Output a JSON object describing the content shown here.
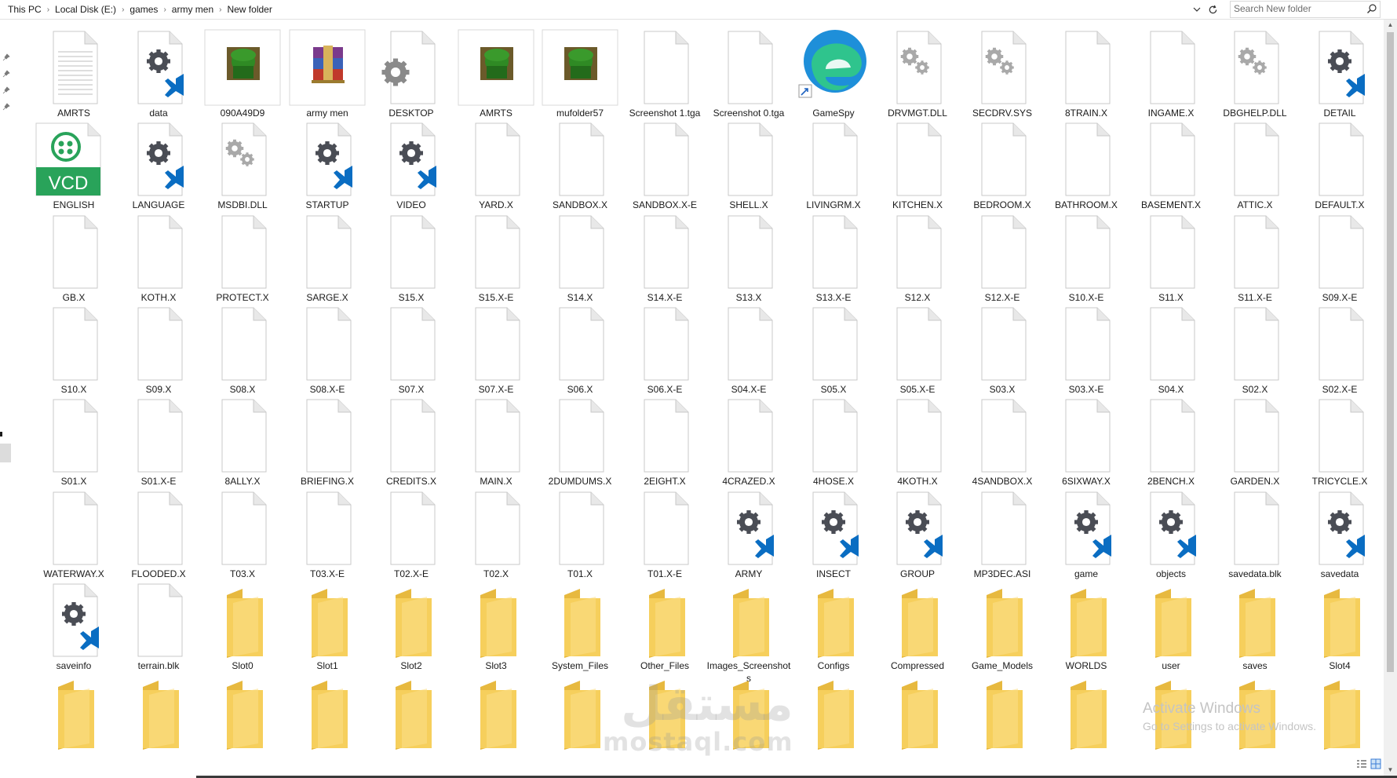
{
  "window": {
    "breadcrumb": [
      "This PC",
      "Local Disk (E:)",
      "games",
      "army men",
      "New folder"
    ],
    "search_placeholder": "Search New folder"
  },
  "colors": {
    "folder": "#f6cf5c",
    "folder_dark": "#e7b93f",
    "gear": "#4a4d55",
    "vscode_blue": "#0a6dc2",
    "soldier_green": "#2f8a24",
    "vcd_green": "#29a35a"
  },
  "items": [
    {
      "label": "AMRTS",
      "icon": "text-doc-icon"
    },
    {
      "label": "data",
      "icon": "vscode-gear-icon"
    },
    {
      "label": "090A49D9",
      "icon": "soldier-image-icon"
    },
    {
      "label": "army men",
      "icon": "winrar-icon"
    },
    {
      "label": "DESKTOP",
      "icon": "gear-file-icon"
    },
    {
      "label": "AMRTS",
      "icon": "soldier-image-icon"
    },
    {
      "label": "mufolder57",
      "icon": "soldier-image-icon"
    },
    {
      "label": "Screenshot 1.tga",
      "icon": "blank-file-icon"
    },
    {
      "label": "Screenshot 0.tga",
      "icon": "blank-file-icon"
    },
    {
      "label": "GameSpy",
      "icon": "edge-shortcut-icon"
    },
    {
      "label": "DRVMGT.DLL",
      "icon": "dll-gear-icon"
    },
    {
      "label": "SECDRV.SYS",
      "icon": "dll-gear-icon"
    },
    {
      "label": "8TRAIN.X",
      "icon": "blank-file-icon"
    },
    {
      "label": "INGAME.X",
      "icon": "blank-file-icon"
    },
    {
      "label": "DBGHELP.DLL",
      "icon": "dll-gear-icon"
    },
    {
      "label": "DETAIL",
      "icon": "vscode-gear-icon"
    },
    {
      "label": "ENGLISH",
      "icon": "vcd-file-icon"
    },
    {
      "label": "LANGUAGE",
      "icon": "vscode-gear-icon"
    },
    {
      "label": "MSDBI.DLL",
      "icon": "dll-gear-icon"
    },
    {
      "label": "STARTUP",
      "icon": "vscode-gear-icon"
    },
    {
      "label": "VIDEO",
      "icon": "vscode-gear-icon"
    },
    {
      "label": "YARD.X",
      "icon": "blank-file-icon"
    },
    {
      "label": "SANDBOX.X",
      "icon": "blank-file-icon"
    },
    {
      "label": "SANDBOX.X-E",
      "icon": "blank-file-icon"
    },
    {
      "label": "SHELL.X",
      "icon": "blank-file-icon"
    },
    {
      "label": "LIVINGRM.X",
      "icon": "blank-file-icon"
    },
    {
      "label": "KITCHEN.X",
      "icon": "blank-file-icon"
    },
    {
      "label": "BEDROOM.X",
      "icon": "blank-file-icon"
    },
    {
      "label": "BATHROOM.X",
      "icon": "blank-file-icon"
    },
    {
      "label": "BASEMENT.X",
      "icon": "blank-file-icon"
    },
    {
      "label": "ATTIC.X",
      "icon": "blank-file-icon"
    },
    {
      "label": "DEFAULT.X",
      "icon": "blank-file-icon"
    },
    {
      "label": "GB.X",
      "icon": "blank-file-icon"
    },
    {
      "label": "KOTH.X",
      "icon": "blank-file-icon"
    },
    {
      "label": "PROTECT.X",
      "icon": "blank-file-icon"
    },
    {
      "label": "SARGE.X",
      "icon": "blank-file-icon"
    },
    {
      "label": "S15.X",
      "icon": "blank-file-icon"
    },
    {
      "label": "S15.X-E",
      "icon": "blank-file-icon"
    },
    {
      "label": "S14.X",
      "icon": "blank-file-icon"
    },
    {
      "label": "S14.X-E",
      "icon": "blank-file-icon"
    },
    {
      "label": "S13.X",
      "icon": "blank-file-icon"
    },
    {
      "label": "S13.X-E",
      "icon": "blank-file-icon"
    },
    {
      "label": "S12.X",
      "icon": "blank-file-icon"
    },
    {
      "label": "S12.X-E",
      "icon": "blank-file-icon"
    },
    {
      "label": "S10.X-E",
      "icon": "blank-file-icon"
    },
    {
      "label": "S11.X",
      "icon": "blank-file-icon"
    },
    {
      "label": "S11.X-E",
      "icon": "blank-file-icon"
    },
    {
      "label": "S09.X-E",
      "icon": "blank-file-icon"
    },
    {
      "label": "S10.X",
      "icon": "blank-file-icon"
    },
    {
      "label": "S09.X",
      "icon": "blank-file-icon"
    },
    {
      "label": "S08.X",
      "icon": "blank-file-icon"
    },
    {
      "label": "S08.X-E",
      "icon": "blank-file-icon"
    },
    {
      "label": "S07.X",
      "icon": "blank-file-icon"
    },
    {
      "label": "S07.X-E",
      "icon": "blank-file-icon"
    },
    {
      "label": "S06.X",
      "icon": "blank-file-icon"
    },
    {
      "label": "S06.X-E",
      "icon": "blank-file-icon"
    },
    {
      "label": "S04.X-E",
      "icon": "blank-file-icon"
    },
    {
      "label": "S05.X",
      "icon": "blank-file-icon"
    },
    {
      "label": "S05.X-E",
      "icon": "blank-file-icon"
    },
    {
      "label": "S03.X",
      "icon": "blank-file-icon"
    },
    {
      "label": "S03.X-E",
      "icon": "blank-file-icon"
    },
    {
      "label": "S04.X",
      "icon": "blank-file-icon"
    },
    {
      "label": "S02.X",
      "icon": "blank-file-icon"
    },
    {
      "label": "S02.X-E",
      "icon": "blank-file-icon"
    },
    {
      "label": "S01.X",
      "icon": "blank-file-icon"
    },
    {
      "label": "S01.X-E",
      "icon": "blank-file-icon"
    },
    {
      "label": "8ALLY.X",
      "icon": "blank-file-icon"
    },
    {
      "label": "BRIEFING.X",
      "icon": "blank-file-icon"
    },
    {
      "label": "CREDITS.X",
      "icon": "blank-file-icon"
    },
    {
      "label": "MAIN.X",
      "icon": "blank-file-icon"
    },
    {
      "label": "2DUMDUMS.X",
      "icon": "blank-file-icon"
    },
    {
      "label": "2EIGHT.X",
      "icon": "blank-file-icon"
    },
    {
      "label": "4CRAZED.X",
      "icon": "blank-file-icon"
    },
    {
      "label": "4HOSE.X",
      "icon": "blank-file-icon"
    },
    {
      "label": "4KOTH.X",
      "icon": "blank-file-icon"
    },
    {
      "label": "4SANDBOX.X",
      "icon": "blank-file-icon"
    },
    {
      "label": "6SIXWAY.X",
      "icon": "blank-file-icon"
    },
    {
      "label": "2BENCH.X",
      "icon": "blank-file-icon"
    },
    {
      "label": "GARDEN.X",
      "icon": "blank-file-icon"
    },
    {
      "label": "TRICYCLE.X",
      "icon": "blank-file-icon"
    },
    {
      "label": "WATERWAY.X",
      "icon": "blank-file-icon"
    },
    {
      "label": "FLOODED.X",
      "icon": "blank-file-icon"
    },
    {
      "label": "T03.X",
      "icon": "blank-file-icon"
    },
    {
      "label": "T03.X-E",
      "icon": "blank-file-icon"
    },
    {
      "label": "T02.X-E",
      "icon": "blank-file-icon"
    },
    {
      "label": "T02.X",
      "icon": "blank-file-icon"
    },
    {
      "label": "T01.X",
      "icon": "blank-file-icon"
    },
    {
      "label": "T01.X-E",
      "icon": "blank-file-icon"
    },
    {
      "label": "ARMY",
      "icon": "vscode-gear-icon"
    },
    {
      "label": "INSECT",
      "icon": "vscode-gear-icon"
    },
    {
      "label": "GROUP",
      "icon": "vscode-gear-icon"
    },
    {
      "label": "MP3DEC.ASI",
      "icon": "blank-file-icon"
    },
    {
      "label": "game",
      "icon": "vscode-gear-icon"
    },
    {
      "label": "objects",
      "icon": "vscode-gear-icon"
    },
    {
      "label": "savedata.blk",
      "icon": "blank-file-icon"
    },
    {
      "label": "savedata",
      "icon": "vscode-gear-icon"
    },
    {
      "label": "saveinfo",
      "icon": "vscode-gear-icon"
    },
    {
      "label": "terrain.blk",
      "icon": "blank-file-icon"
    },
    {
      "label": "Slot0",
      "icon": "folder-icon"
    },
    {
      "label": "Slot1",
      "icon": "folder-icon"
    },
    {
      "label": "Slot2",
      "icon": "folder-icon"
    },
    {
      "label": "Slot3",
      "icon": "folder-icon"
    },
    {
      "label": "System_Files",
      "icon": "folder-icon"
    },
    {
      "label": "Other_Files",
      "icon": "folder-icon"
    },
    {
      "label": "Images_Screenshots",
      "icon": "folder-icon"
    },
    {
      "label": "Configs",
      "icon": "folder-icon"
    },
    {
      "label": "Compressed",
      "icon": "folder-icon"
    },
    {
      "label": "Game_Models",
      "icon": "folder-icon"
    },
    {
      "label": "WORLDS",
      "icon": "folder-icon"
    },
    {
      "label": "user",
      "icon": "folder-icon"
    },
    {
      "label": "saves",
      "icon": "folder-icon"
    },
    {
      "label": "Slot4",
      "icon": "folder-icon"
    },
    {
      "label": "",
      "icon": "folder-icon"
    },
    {
      "label": "",
      "icon": "folder-icon"
    },
    {
      "label": "",
      "icon": "folder-icon"
    },
    {
      "label": "",
      "icon": "folder-icon"
    },
    {
      "label": "",
      "icon": "folder-icon"
    },
    {
      "label": "",
      "icon": "folder-icon"
    },
    {
      "label": "",
      "icon": "folder-icon"
    },
    {
      "label": "",
      "icon": "folder-icon"
    },
    {
      "label": "",
      "icon": "folder-icon"
    },
    {
      "label": "",
      "icon": "folder-icon"
    },
    {
      "label": "",
      "icon": "folder-icon"
    },
    {
      "label": "",
      "icon": "folder-icon"
    },
    {
      "label": "",
      "icon": "folder-icon"
    },
    {
      "label": "",
      "icon": "folder-icon"
    },
    {
      "label": "",
      "icon": "folder-icon"
    },
    {
      "label": "",
      "icon": "folder-icon"
    }
  ],
  "overlay": {
    "activate_title": "Activate Windows",
    "activate_sub": "Go to Settings to activate Windows.",
    "watermark_main": "مستقل",
    "watermark_sub": "mostaql.com"
  }
}
